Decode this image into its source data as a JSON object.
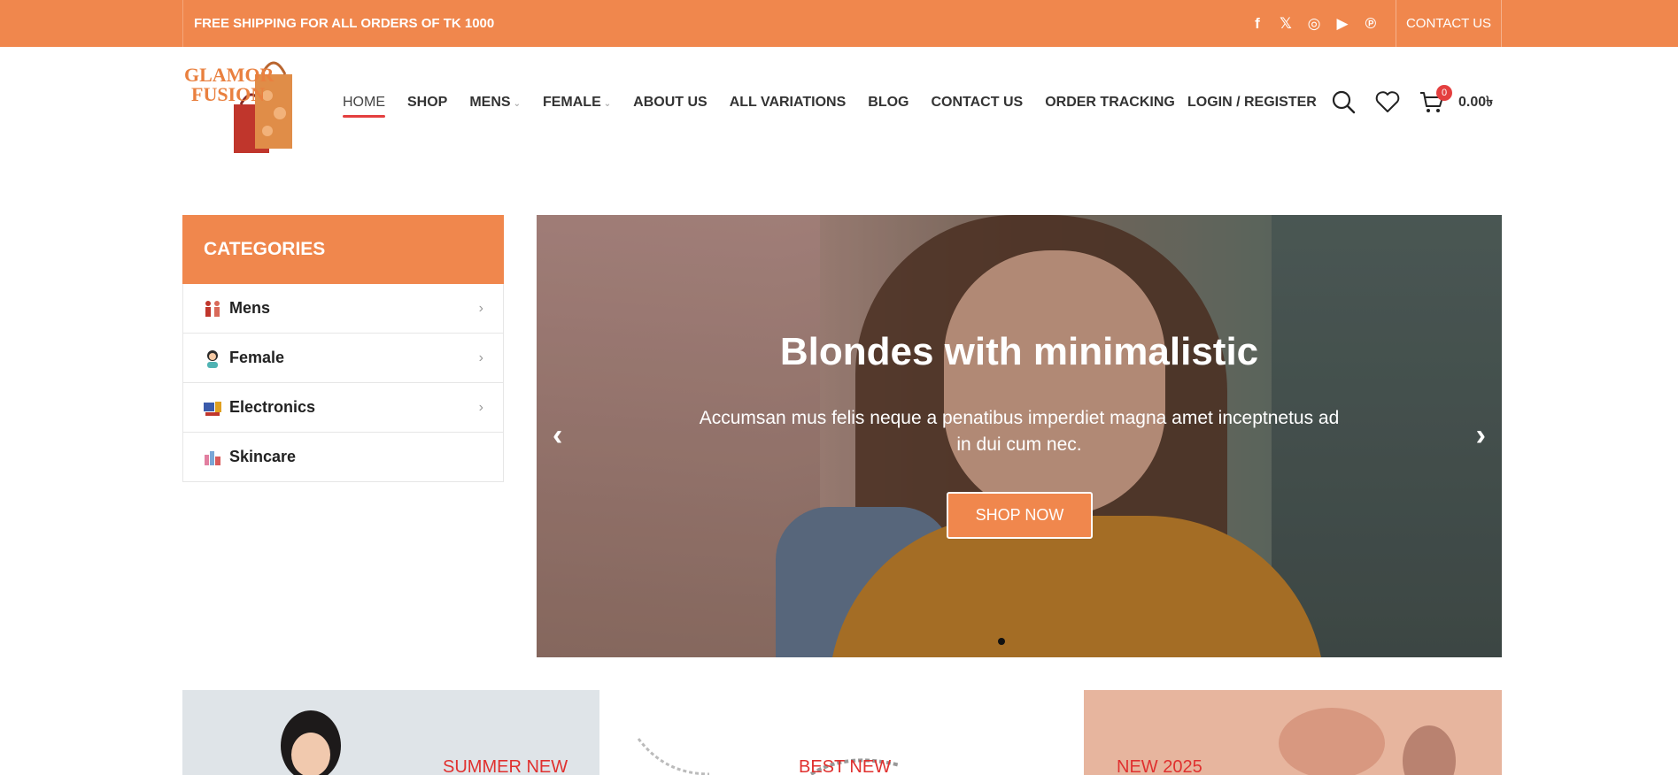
{
  "topbar": {
    "shipping_text": "FREE SHIPPING FOR ALL ORDERS OF TK 1000",
    "social_icons": [
      "facebook-icon",
      "x-icon",
      "instagram-icon",
      "youtube-icon",
      "pinterest-icon"
    ],
    "social_glyphs": [
      "f",
      "𝕏",
      "◎",
      "▶",
      "℗"
    ],
    "contact_label": "CONTACT US",
    "background_color": "#f0874d"
  },
  "logo": {
    "line1": "GLAMOR",
    "line2": "FUSION"
  },
  "nav": {
    "items": [
      {
        "label": "HOME",
        "active": true
      },
      {
        "label": "SHOP"
      },
      {
        "label": "MENS",
        "has_dropdown": true
      },
      {
        "label": "FEMALE",
        "has_dropdown": true
      },
      {
        "label": "ABOUT US"
      },
      {
        "label": "ALL VARIATIONS"
      },
      {
        "label": "BLOG"
      },
      {
        "label": "CONTACT US"
      },
      {
        "label": "ORDER TRACKING"
      }
    ],
    "caret": "⌄",
    "login_label": "LOGIN / REGISTER",
    "cart_count": "0",
    "cart_total": "0.00৳"
  },
  "categories": {
    "title": "CATEGORIES",
    "items": [
      {
        "label": "Mens",
        "chevron": "›"
      },
      {
        "label": "Female",
        "chevron": "›"
      },
      {
        "label": "Electronics",
        "chevron": "›"
      },
      {
        "label": "Skincare",
        "chevron": ""
      }
    ]
  },
  "hero": {
    "title": "Blondes with minimalistic",
    "description": "Accumsan mus felis neque a penatibus imperdiet magna amet inceptnetus ad in dui cum nec.",
    "button_label": "SHOP NOW",
    "prev_arrow": "‹",
    "next_arrow": "›",
    "accent_color": "#f0874d"
  },
  "promos": [
    {
      "label": "SUMMER NEW"
    },
    {
      "label": "BEST NEW"
    },
    {
      "label": "NEW 2025"
    }
  ]
}
